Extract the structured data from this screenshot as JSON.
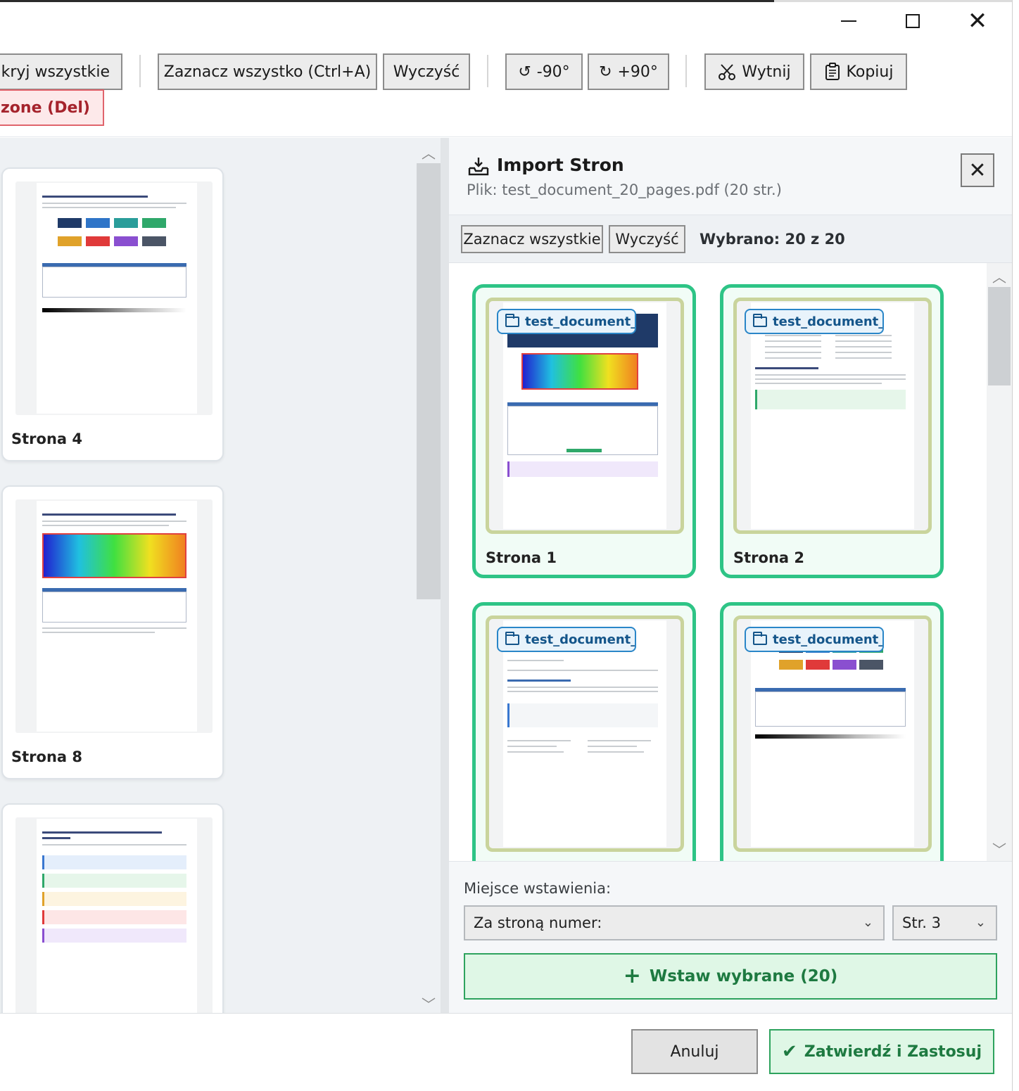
{
  "window": {
    "minimize_icon": "minimize-icon",
    "maximize_icon": "maximize-icon",
    "close_icon": "close-icon"
  },
  "toolbar": {
    "show_all_label": "dkryj wszystkie",
    "select_all_label": "Zaznacz wszystko (Ctrl+A)",
    "clear_label": "Wyczyść",
    "rotate_left_icon": "↺",
    "rotate_left_label": "-90°",
    "rotate_right_icon": "↻",
    "rotate_right_label": "+90°",
    "cut_label": "Wytnij",
    "copy_label": "Kopiuj",
    "delete_label": "czone (Del)"
  },
  "left_pages": [
    {
      "label": "Strona 4"
    },
    {
      "label": "Strona 8"
    },
    {
      "label": ""
    }
  ],
  "import_panel": {
    "title": "Import Stron",
    "file_info": "Plik: test_document_20_pages.pdf (20 str.)",
    "select_all_label": "Zaznacz wszystkie",
    "clear_label": "Wyczyść",
    "selected_count": "Wybrano: 20 z 20",
    "pages": [
      {
        "label": "Strona 1",
        "source": "test_document_..."
      },
      {
        "label": "Strona 2",
        "source": "test_document_..."
      },
      {
        "label": "",
        "source": "test_document_..."
      },
      {
        "label": "",
        "source": "test_document_..."
      }
    ],
    "insert_position_label": "Miejsce wstawienia:",
    "position_mode": "Za stroną numer:",
    "position_page": "Str. 3",
    "insert_button": "Wstaw wybrane (20)"
  },
  "footer": {
    "cancel_label": "Anuluj",
    "apply_label": "Zatwierdź i Zastosuj"
  },
  "colors": {
    "accent_green": "#2ec486",
    "danger_red": "#e0646c",
    "badge_blue": "#2a86c8"
  }
}
